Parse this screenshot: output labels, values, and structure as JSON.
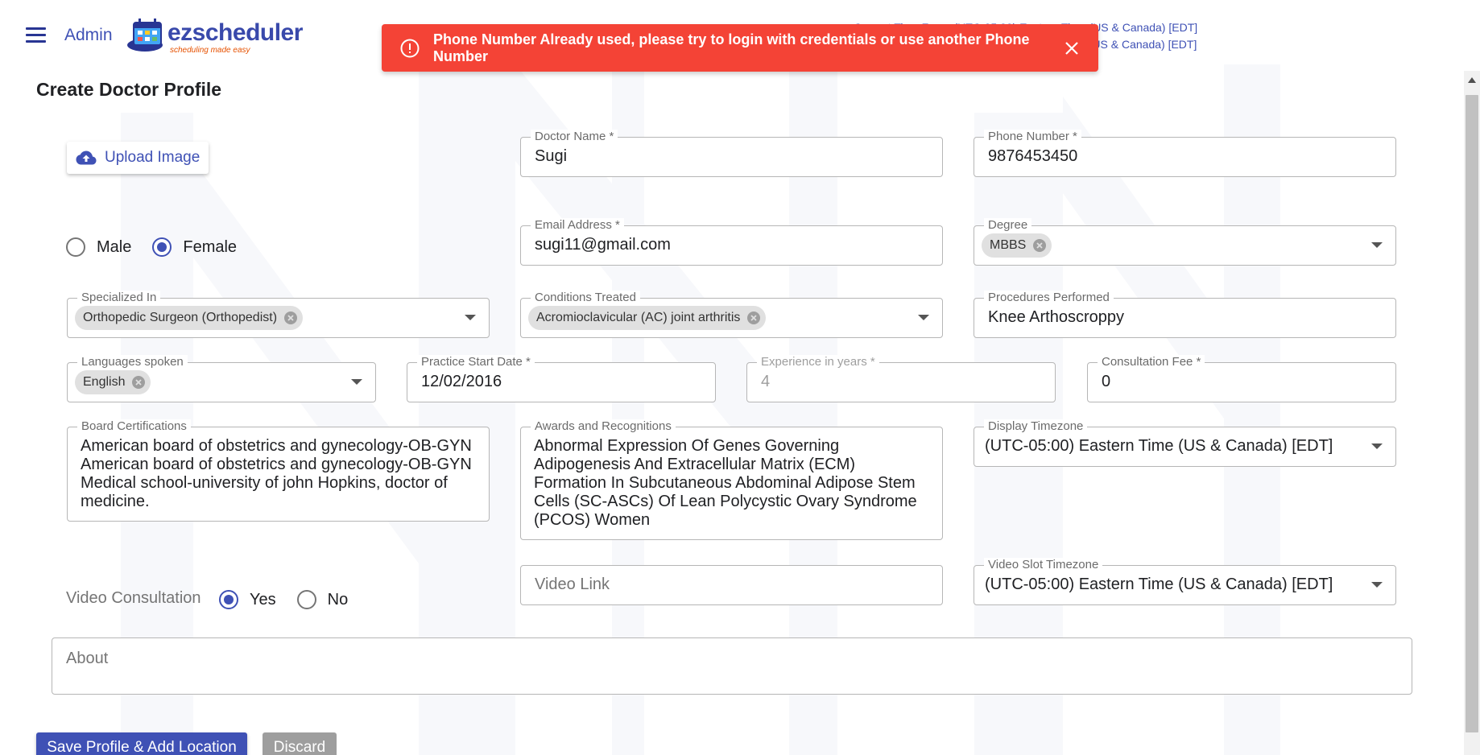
{
  "header": {
    "admin_label": "Admin",
    "logo_text": "ezscheduler",
    "logo_tagline": "scheduling made easy",
    "timezone_line1": "Current Time Zone: (UTC-05:00) Eastern Time (US & Canada) [EDT]",
    "timezone_line2": "Display Time Zone: (UTC-05:00) Eastern Time (US & Canada) [EDT]"
  },
  "alert": {
    "message": "Phone Number Already used, please try to login with credentials or use another Phone Number",
    "color": "#f44336"
  },
  "page_title": "Create Doctor Profile",
  "upload_button": {
    "label": "Upload Image"
  },
  "gender": {
    "options": [
      "Male",
      "Female"
    ],
    "selected": "Female"
  },
  "fields": {
    "doctor_name": {
      "label": "Doctor Name *",
      "value": "Sugi"
    },
    "phone_number": {
      "label": "Phone Number *",
      "value": "9876453450"
    },
    "email": {
      "label": "Email Address *",
      "value": "sugi11@gmail.com"
    },
    "degree": {
      "label": "Degree",
      "chip": "MBBS"
    },
    "specialized_in": {
      "label": "Specialized In",
      "chip": "Orthopedic Surgeon (Orthopedist)"
    },
    "conditions_treated": {
      "label": "Conditions Treated",
      "chip": "Acromioclavicular (AC) joint arthritis"
    },
    "procedures_performed": {
      "label": "Procedures Performed",
      "value": "Knee Arthoscroppy"
    },
    "languages_spoken": {
      "label": "Languages spoken",
      "chip": "English"
    },
    "practice_start_date": {
      "label": "Practice Start Date *",
      "value": "12/02/2016"
    },
    "experience_years": {
      "label": "Experience in years *",
      "value": "4"
    },
    "consultation_fee": {
      "label": "Consultation Fee  *",
      "value": "0"
    },
    "board_certifications": {
      "label": "Board Certifications",
      "value": "American board of obstetrics and gynecology-OB-GYN American board of obstetrics and gynecology-OB-GYN Medical school-university of john Hopkins, doctor of medicine."
    },
    "awards": {
      "label": "Awards and Recognitions",
      "value": "Abnormal Expression Of Genes Governing Adipogenesis And Extracellular Matrix (ECM) Formation In Subcutaneous Abdominal Adipose Stem Cells (SC-ASCs) Of Lean Polycystic Ovary Syndrome (PCOS) Women"
    },
    "display_timezone": {
      "label": "Display Timezone",
      "value": "(UTC-05:00) Eastern Time (US & Canada) [EDT]"
    },
    "video_link": {
      "placeholder": "Video Link"
    },
    "video_slot_timezone": {
      "label": "Video Slot Timezone",
      "value": "(UTC-05:00) Eastern Time (US & Canada) [EDT]"
    },
    "about": {
      "placeholder": "About"
    }
  },
  "video_consultation": {
    "label": "Video Consultation",
    "options": [
      "Yes",
      "No"
    ],
    "selected": "Yes"
  },
  "buttons": {
    "save": "Save Profile & Add Location",
    "discard": "Discard"
  },
  "colors": {
    "primary": "#3f51b5",
    "alert": "#f44336",
    "discard": "#9e9e9e"
  }
}
